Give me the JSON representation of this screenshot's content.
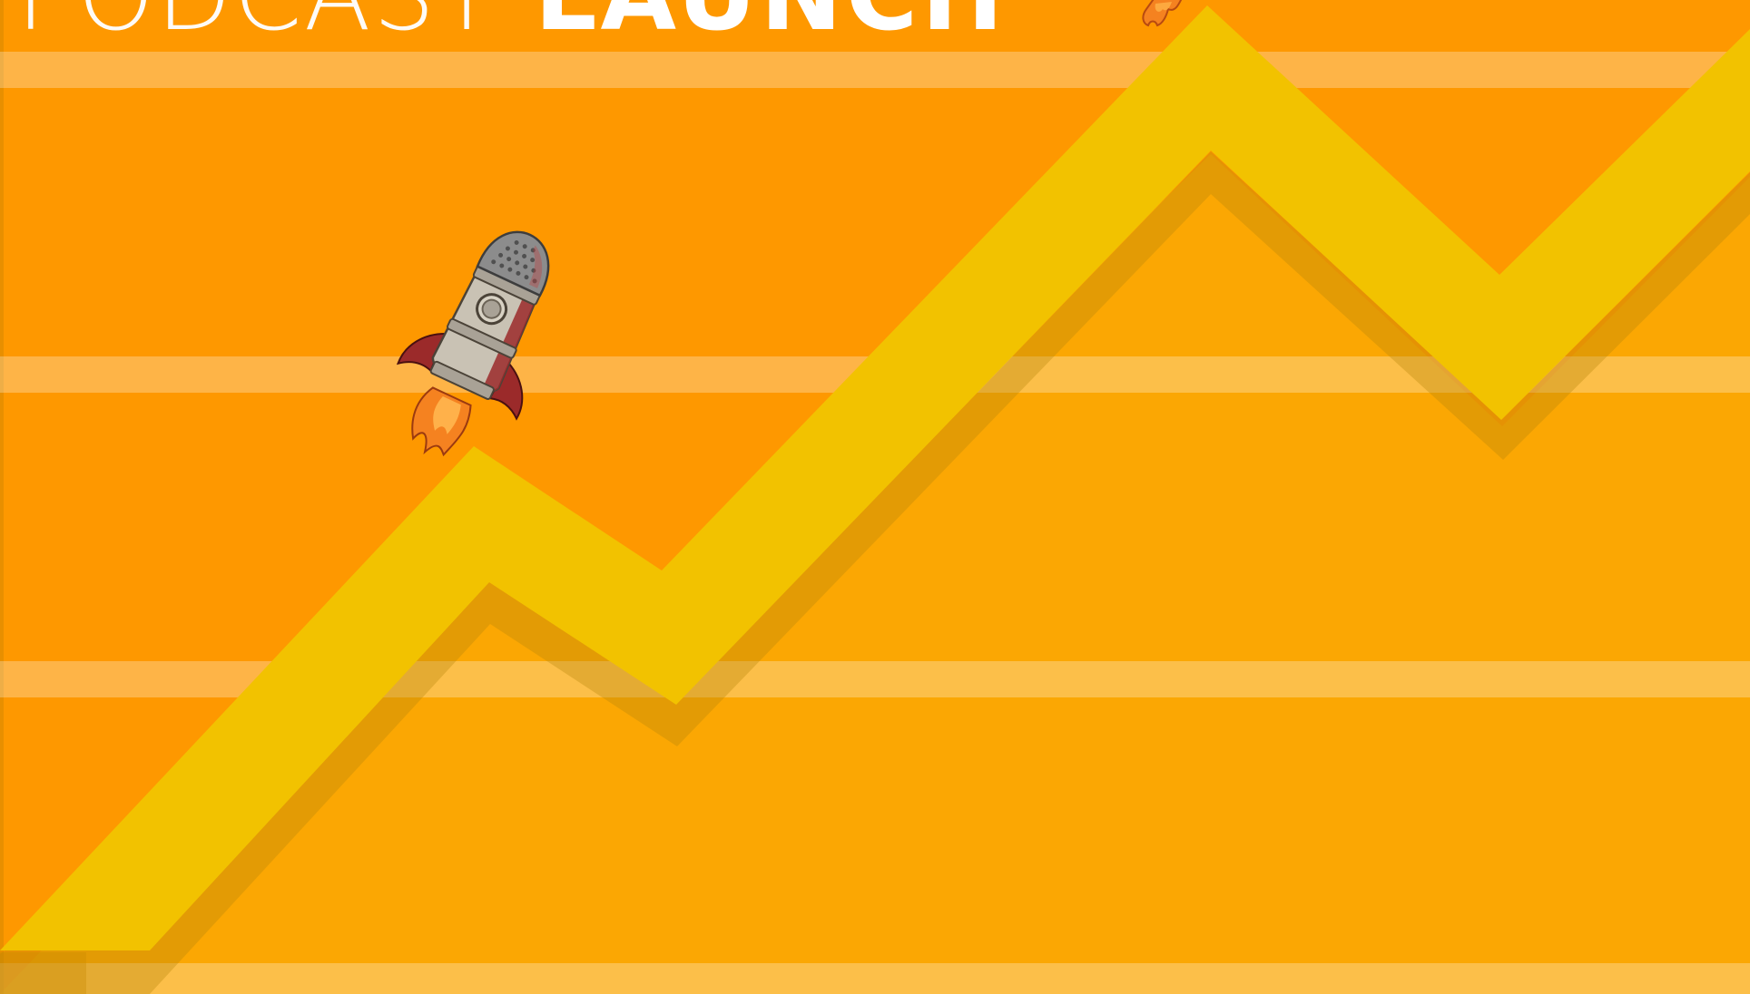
{
  "cover": {
    "title_light": "PODCAST",
    "title_bold": "LAUNCH"
  },
  "icons": {
    "main": "microphone-rocket-icon",
    "small": "rocket-flame-icon"
  },
  "colors": {
    "background_top": "#fe9800",
    "background_bottom": "#fba703",
    "stripe": "#ffd070",
    "trend_line": "#f2c200",
    "trend_shadow": "#d98f00",
    "title_text": "#ffffff",
    "rocket_body": "#c9c2b4",
    "rocket_red": "#9b2a2a",
    "flame": "#f58220"
  }
}
